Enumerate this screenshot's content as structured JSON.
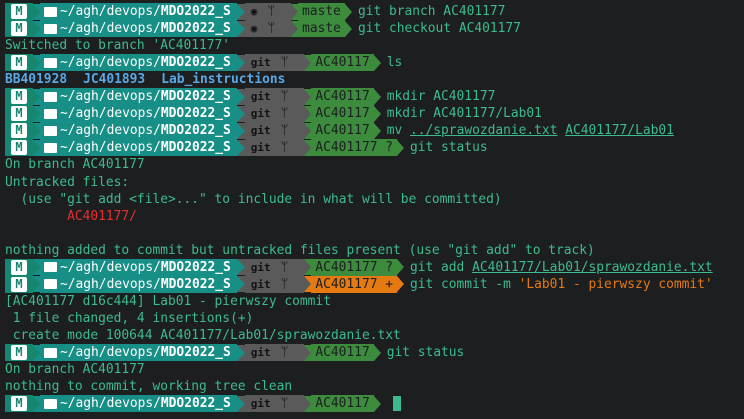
{
  "prompt": {
    "os_logo": "M",
    "path_prefix": "~/agh/devops/",
    "path_bold": "MDO2022_S",
    "git_label": "git",
    "github_icon": "github-icon",
    "branch_icon": "branch-icon"
  },
  "lines": [
    {
      "kind": "prompt",
      "variant": "cat",
      "branch": "maste",
      "cmd": "git branch AC401177"
    },
    {
      "kind": "prompt",
      "variant": "cat",
      "branch": "maste",
      "cmd": "git checkout AC401177"
    },
    {
      "kind": "out",
      "text": "Switched to branch 'AC401177'"
    },
    {
      "kind": "prompt",
      "variant": "git",
      "branch": "AC40117",
      "cmd": "ls"
    },
    {
      "kind": "ls",
      "items": [
        "BB401928",
        "JC401893",
        "Lab_instructions"
      ]
    },
    {
      "kind": "prompt",
      "variant": "git",
      "branch": "AC40117",
      "cmd": "mkdir AC401177"
    },
    {
      "kind": "prompt",
      "variant": "git",
      "branch": "AC40117",
      "cmd": "mkdir AC401177/Lab01"
    },
    {
      "kind": "prompt",
      "variant": "git",
      "branch": "AC40117",
      "cmd_parts": [
        {
          "t": "mv "
        },
        {
          "t": "../sprawozdanie.txt",
          "u": true
        },
        {
          "t": " "
        },
        {
          "t": "AC401177/Lab01",
          "u": true
        }
      ]
    },
    {
      "kind": "prompt",
      "variant": "git",
      "branch": "AC401177 ?",
      "cmd": "git status"
    },
    {
      "kind": "out",
      "text": "On branch AC401177"
    },
    {
      "kind": "out",
      "text": "Untracked files:"
    },
    {
      "kind": "out",
      "text": "  (use \"git add <file>...\" to include in what will be committed)"
    },
    {
      "kind": "red",
      "text": "        AC401177/"
    },
    {
      "kind": "blank",
      "text": ""
    },
    {
      "kind": "out",
      "text": "nothing added to commit but untracked files present (use \"git add\" to track)"
    },
    {
      "kind": "prompt",
      "variant": "git",
      "branch": "AC401177 ?",
      "cmd_parts": [
        {
          "t": "git add "
        },
        {
          "t": "AC401177/Lab01/sprawozdanie.txt",
          "u": true
        }
      ]
    },
    {
      "kind": "prompt",
      "variant": "orange",
      "branch": "AC401177 +",
      "cmd_parts": [
        {
          "t": "git commit -m "
        },
        {
          "t": "'Lab01 - pierwszy commit'",
          "o": true
        }
      ]
    },
    {
      "kind": "out",
      "text": "[AC401177 d16c444] Lab01 - pierwszy commit"
    },
    {
      "kind": "out",
      "text": " 1 file changed, 4 insertions(+)"
    },
    {
      "kind": "out",
      "text": " create mode 100644 AC401177/Lab01/sprawozdanie.txt"
    },
    {
      "kind": "prompt",
      "variant": "git",
      "branch": "AC40117",
      "cmd": "git status"
    },
    {
      "kind": "out",
      "text": "On branch AC401177"
    },
    {
      "kind": "out",
      "text": "nothing to commit, working tree clean"
    },
    {
      "kind": "prompt",
      "variant": "git",
      "branch": "AC40117",
      "cmd": "",
      "cursor": true
    }
  ],
  "colors": {
    "background": "#1c1e20",
    "text": "#3dbb8f",
    "os_segment": "#15866f",
    "path_segment": "#178f86",
    "git_gray": "#5a5a5a",
    "git_green": "#3d8b3d",
    "git_orange": "#e57912",
    "error_red": "#e5302e",
    "dir_blue": "#5aa9e6"
  }
}
